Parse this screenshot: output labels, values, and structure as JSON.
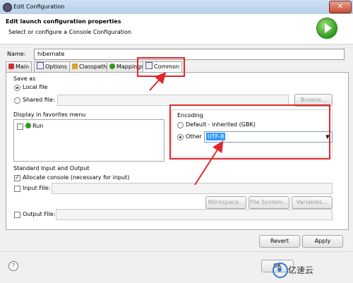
{
  "window": {
    "title": "Edit Configuration"
  },
  "header": {
    "title": "Edit launch configuration properties",
    "subtitle": "Select or configure a Console Configuration"
  },
  "name": {
    "label": "Name:",
    "value": "hibernate"
  },
  "tabs": [
    {
      "label": "Main",
      "icon": "main-tab-icon"
    },
    {
      "label": "Options",
      "icon": "options-tab-icon"
    },
    {
      "label": "Classpath",
      "icon": "classpath-tab-icon"
    },
    {
      "label": "Mappings",
      "icon": "mappings-tab-icon"
    },
    {
      "label": "Common",
      "icon": "common-tab-icon",
      "active": true
    }
  ],
  "save_as": {
    "title": "Save as",
    "local_label": "Local file",
    "shared_label": "Shared file:",
    "browse": "Browse..."
  },
  "favorites": {
    "title": "Display in favorites menu",
    "items": [
      {
        "label": "Run",
        "checked": false
      }
    ]
  },
  "encoding": {
    "title": "Encoding",
    "default_label": "Default - inherited (GBK)",
    "other_label": "Other",
    "other_value": "UTF-8"
  },
  "std_io": {
    "title": "Standard Input and Output",
    "allocate_label": "Allocate console (necessary for input)",
    "input_file_label": "Input File:",
    "workspace": "Workspace...",
    "file_system": "File System...",
    "variables": "Variables...",
    "output_file_label": "Output File:"
  },
  "buttons": {
    "revert": "Revert",
    "apply": "Apply",
    "ok": "OK"
  },
  "watermark": {
    "text": "亿速云"
  },
  "colors": {
    "annotation": "#e0282c",
    "selection": "#3399ff",
    "run_green": "#2f9a1c"
  }
}
